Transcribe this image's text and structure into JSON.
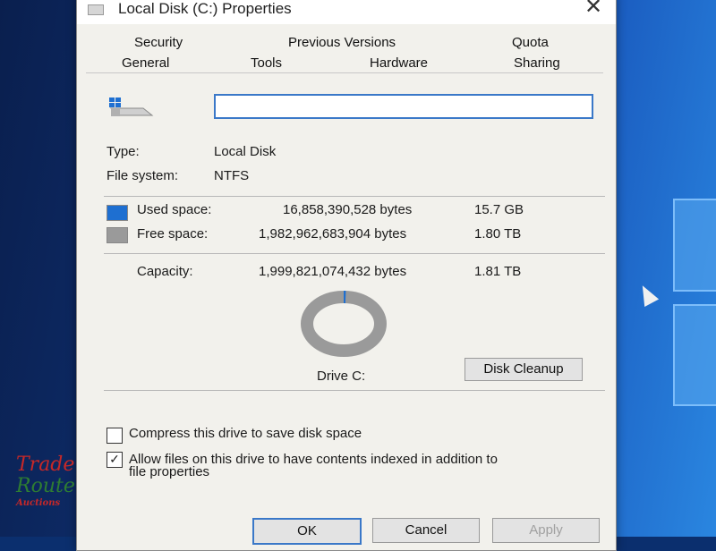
{
  "window": {
    "title": "Local Disk (C:) Properties",
    "close_glyph": "✕"
  },
  "tabs": [
    {
      "label": "Security"
    },
    {
      "label": "Previous Versions"
    },
    {
      "label": "Quota"
    },
    {
      "label": "General"
    },
    {
      "label": "Tools"
    },
    {
      "label": "Hardware"
    },
    {
      "label": "Sharing"
    }
  ],
  "general": {
    "name_value": "",
    "type_label": "Type:",
    "type_value": "Local Disk",
    "fs_label": "File system:",
    "fs_value": "NTFS",
    "used": {
      "label": "Used space:",
      "bytes": "16,858,390,528 bytes",
      "size": "15.7 GB",
      "color": "#1e6fd1"
    },
    "free": {
      "label": "Free space:",
      "bytes": "1,982,962,683,904 bytes",
      "size": "1.80 TB",
      "color": "#9a9a9a"
    },
    "capacity": {
      "label": "Capacity:",
      "bytes": "1,999,821,074,432 bytes",
      "size": "1.81 TB"
    },
    "usage_fraction": 0.0084,
    "drive_label": "Drive C:",
    "cleanup_label": "Disk Cleanup",
    "compress_label": "Compress this drive to save disk space",
    "compress_checked": false,
    "index_label_line1": "Allow files on this drive to have contents indexed in addition to",
    "index_label_line2": "file properties",
    "index_checked": true
  },
  "buttons": {
    "ok": "OK",
    "cancel": "Cancel",
    "apply": "Apply"
  },
  "watermark": {
    "line1": "Trade",
    "line2": "Route",
    "line3": "Auctions"
  }
}
